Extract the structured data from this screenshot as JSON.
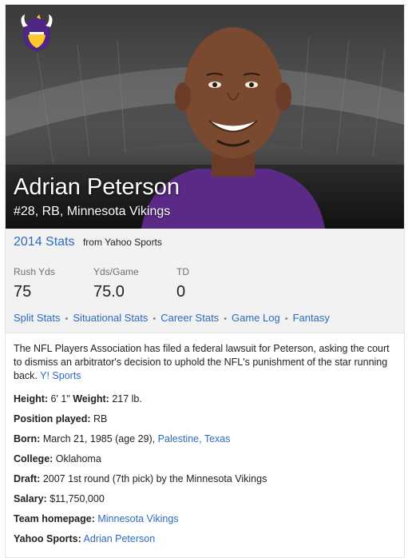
{
  "hero": {
    "name": "Adrian Peterson",
    "subtitle": "#28, RB, Minnesota Vikings",
    "logo_icon": "vikings-helmet-logo",
    "photo": "player-headshot",
    "team_color": "#4f2683"
  },
  "stats": {
    "title": "2014 Stats",
    "source": "from Yahoo Sports",
    "items": [
      {
        "label": "Rush Yds",
        "value": "75"
      },
      {
        "label": "Yds/Game",
        "value": "75.0"
      },
      {
        "label": "TD",
        "value": "0"
      }
    ],
    "links": [
      "Split Stats",
      "Situational Stats",
      "Career Stats",
      "Game Log",
      "Fantasy"
    ]
  },
  "description": {
    "text": "The NFL Players Association has filed a federal lawsuit for Peterson, asking the court to dismiss an arbitrator's decision to uphold the NFL's punishment of the star running back.",
    "source_link": "Y! Sports"
  },
  "facts": {
    "height_label": "Height:",
    "height_value": "6' 1\"",
    "weight_label": "Weight:",
    "weight_value": "217 lb.",
    "position_label": "Position played:",
    "position_value": "RB",
    "born_label": "Born:",
    "born_value": "March 21, 1985 (age 29),",
    "born_place": "Palestine, Texas",
    "college_label": "College:",
    "college_value": "Oklahoma",
    "draft_label": "Draft:",
    "draft_value": "2007 1st round (7th pick) by the Minnesota Vikings",
    "salary_label": "Salary:",
    "salary_value": "$11,750,000",
    "homepage_label": "Team homepage:",
    "homepage_value": "Minnesota Vikings",
    "yahoo_label": "Yahoo Sports:",
    "yahoo_value": "Adrian Peterson"
  }
}
